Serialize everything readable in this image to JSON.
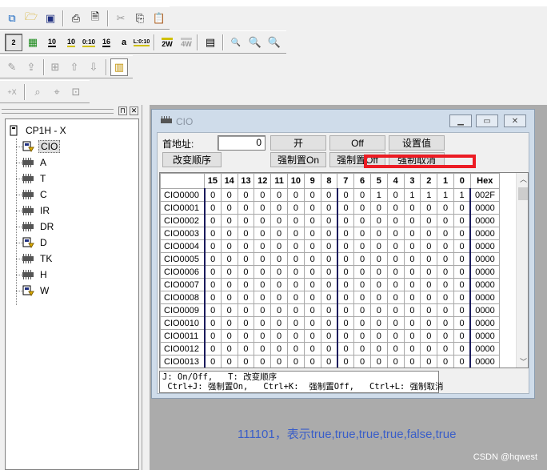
{
  "toolbar_row2": {
    "btn_2": "2",
    "btn_10a": "10",
    "btn_10b": "10",
    "btn_010": "0:10",
    "btn_16": "16",
    "btn_a": "a",
    "btn_l010": "L:0:10",
    "btn_2w": "2W",
    "btn_4w": "4W"
  },
  "tree": {
    "root": "CP1H - X",
    "items": [
      "CIO",
      "A",
      "T",
      "C",
      "IR",
      "DR",
      "D",
      "TK",
      "H",
      "W"
    ]
  },
  "window": {
    "title": "CIO",
    "address_label": "首地址:",
    "address_value": "0",
    "btn_on": "开",
    "btn_off": "Off",
    "btn_set": "设置值",
    "btn_change_order": "改变顺序",
    "btn_force_on": "强制置On",
    "btn_force_off": "强制置Off",
    "btn_force_cancel": "强制取消"
  },
  "grid": {
    "headers": [
      "15",
      "14",
      "13",
      "12",
      "11",
      "10",
      "9",
      "8",
      "7",
      "6",
      "5",
      "4",
      "3",
      "2",
      "1",
      "0",
      "Hex"
    ],
    "rows": [
      {
        "addr": "CIO0000",
        "bits": [
          "0",
          "0",
          "0",
          "0",
          "0",
          "0",
          "0",
          "0",
          "0",
          "0",
          "1",
          "0",
          "1",
          "1",
          "1",
          "1"
        ],
        "hex": "002F"
      },
      {
        "addr": "CIO0001",
        "bits": [
          "0",
          "0",
          "0",
          "0",
          "0",
          "0",
          "0",
          "0",
          "0",
          "0",
          "0",
          "0",
          "0",
          "0",
          "0",
          "0"
        ],
        "hex": "0000"
      },
      {
        "addr": "CIO0002",
        "bits": [
          "0",
          "0",
          "0",
          "0",
          "0",
          "0",
          "0",
          "0",
          "0",
          "0",
          "0",
          "0",
          "0",
          "0",
          "0",
          "0"
        ],
        "hex": "0000"
      },
      {
        "addr": "CIO0003",
        "bits": [
          "0",
          "0",
          "0",
          "0",
          "0",
          "0",
          "0",
          "0",
          "0",
          "0",
          "0",
          "0",
          "0",
          "0",
          "0",
          "0"
        ],
        "hex": "0000"
      },
      {
        "addr": "CIO0004",
        "bits": [
          "0",
          "0",
          "0",
          "0",
          "0",
          "0",
          "0",
          "0",
          "0",
          "0",
          "0",
          "0",
          "0",
          "0",
          "0",
          "0"
        ],
        "hex": "0000"
      },
      {
        "addr": "CIO0005",
        "bits": [
          "0",
          "0",
          "0",
          "0",
          "0",
          "0",
          "0",
          "0",
          "0",
          "0",
          "0",
          "0",
          "0",
          "0",
          "0",
          "0"
        ],
        "hex": "0000"
      },
      {
        "addr": "CIO0006",
        "bits": [
          "0",
          "0",
          "0",
          "0",
          "0",
          "0",
          "0",
          "0",
          "0",
          "0",
          "0",
          "0",
          "0",
          "0",
          "0",
          "0"
        ],
        "hex": "0000"
      },
      {
        "addr": "CIO0007",
        "bits": [
          "0",
          "0",
          "0",
          "0",
          "0",
          "0",
          "0",
          "0",
          "0",
          "0",
          "0",
          "0",
          "0",
          "0",
          "0",
          "0"
        ],
        "hex": "0000"
      },
      {
        "addr": "CIO0008",
        "bits": [
          "0",
          "0",
          "0",
          "0",
          "0",
          "0",
          "0",
          "0",
          "0",
          "0",
          "0",
          "0",
          "0",
          "0",
          "0",
          "0"
        ],
        "hex": "0000"
      },
      {
        "addr": "CIO0009",
        "bits": [
          "0",
          "0",
          "0",
          "0",
          "0",
          "0",
          "0",
          "0",
          "0",
          "0",
          "0",
          "0",
          "0",
          "0",
          "0",
          "0"
        ],
        "hex": "0000"
      },
      {
        "addr": "CIO0010",
        "bits": [
          "0",
          "0",
          "0",
          "0",
          "0",
          "0",
          "0",
          "0",
          "0",
          "0",
          "0",
          "0",
          "0",
          "0",
          "0",
          "0"
        ],
        "hex": "0000"
      },
      {
        "addr": "CIO0011",
        "bits": [
          "0",
          "0",
          "0",
          "0",
          "0",
          "0",
          "0",
          "0",
          "0",
          "0",
          "0",
          "0",
          "0",
          "0",
          "0",
          "0"
        ],
        "hex": "0000"
      },
      {
        "addr": "CIO0012",
        "bits": [
          "0",
          "0",
          "0",
          "0",
          "0",
          "0",
          "0",
          "0",
          "0",
          "0",
          "0",
          "0",
          "0",
          "0",
          "0",
          "0"
        ],
        "hex": "0000"
      },
      {
        "addr": "CIO0013",
        "bits": [
          "0",
          "0",
          "0",
          "0",
          "0",
          "0",
          "0",
          "0",
          "0",
          "0",
          "0",
          "0",
          "0",
          "0",
          "0",
          "0"
        ],
        "hex": "0000"
      }
    ]
  },
  "hint": {
    "line1": "J: On/Off,   T: 改变顺序",
    "line2": " Ctrl+J: 强制置On,   Ctrl+K:  强制置Off,   Ctrl+L: 强制取消"
  },
  "annotation": "111101，表示true,true,true,true,false,true",
  "watermark": "CSDN @hqwest",
  "colors": {
    "highlight": "#ec1c24",
    "annotation": "#3a5ec8",
    "mdi_bg": "#ababab",
    "window_frame": "#cfdcea"
  }
}
